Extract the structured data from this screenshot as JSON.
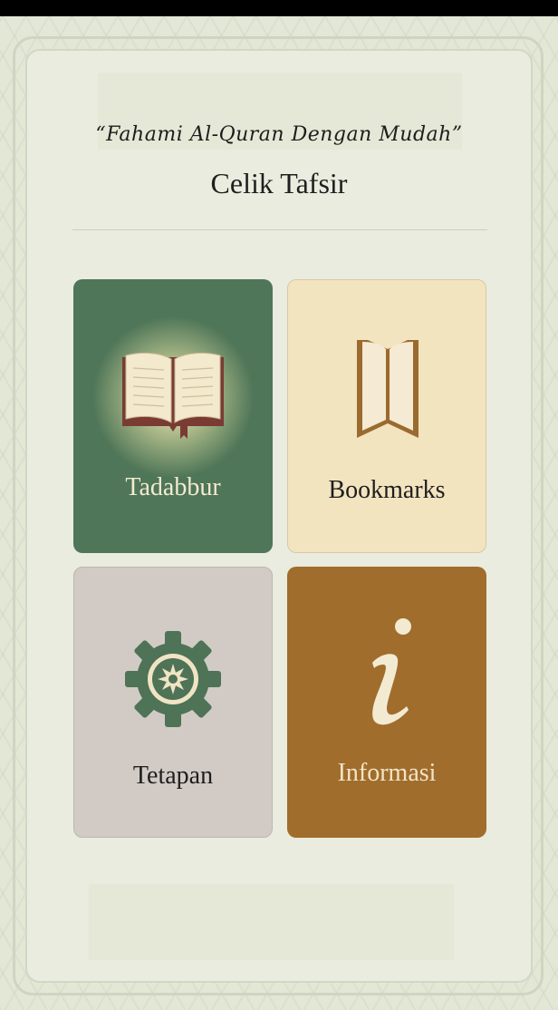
{
  "header": {
    "tagline": "“Fahami Al-Quran Dengan Mudah”",
    "title": "Celik Tafsir"
  },
  "menu": {
    "tadabbur": {
      "label": "Tadabbur",
      "icon": "open-book-icon",
      "color": "#4f7658"
    },
    "bookmarks": {
      "label": "Bookmarks",
      "icon": "bookmark-book-icon",
      "color": "#f3e4c0"
    },
    "tetapan": {
      "label": "Tetapan",
      "icon": "gear-icon",
      "color": "#d2cbc5"
    },
    "informasi": {
      "label": "Informasi",
      "icon": "info-icon",
      "color": "#a06d2c"
    }
  },
  "colors": {
    "background": "#e3e7d6",
    "accent_green": "#4f7658",
    "accent_brown": "#a06d2c"
  }
}
